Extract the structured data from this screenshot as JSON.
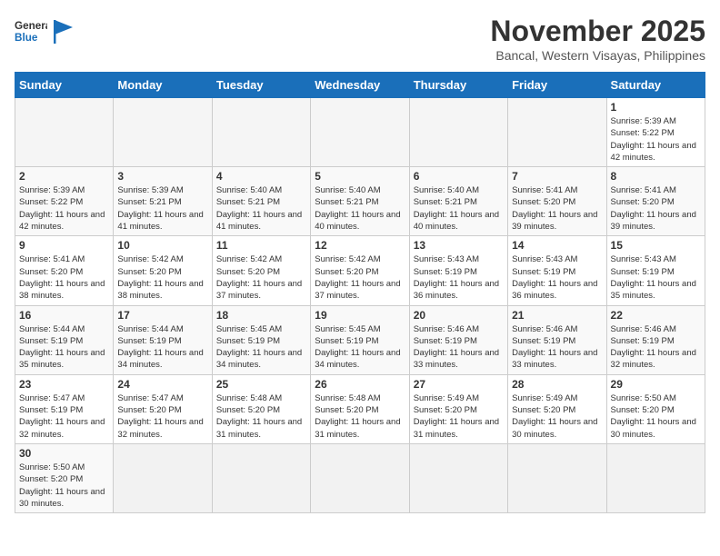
{
  "header": {
    "logo_line1": "General",
    "logo_line2": "Blue",
    "month_title": "November 2025",
    "location": "Bancal, Western Visayas, Philippines"
  },
  "weekdays": [
    "Sunday",
    "Monday",
    "Tuesday",
    "Wednesday",
    "Thursday",
    "Friday",
    "Saturday"
  ],
  "days": [
    {
      "date": null,
      "info": ""
    },
    {
      "date": null,
      "info": ""
    },
    {
      "date": null,
      "info": ""
    },
    {
      "date": null,
      "info": ""
    },
    {
      "date": null,
      "info": ""
    },
    {
      "date": null,
      "info": ""
    },
    {
      "date": "1",
      "info": "Sunrise: 5:39 AM\nSunset: 5:22 PM\nDaylight: 11 hours and 42 minutes."
    },
    {
      "date": "2",
      "info": "Sunrise: 5:39 AM\nSunset: 5:22 PM\nDaylight: 11 hours and 42 minutes."
    },
    {
      "date": "3",
      "info": "Sunrise: 5:39 AM\nSunset: 5:21 PM\nDaylight: 11 hours and 41 minutes."
    },
    {
      "date": "4",
      "info": "Sunrise: 5:40 AM\nSunset: 5:21 PM\nDaylight: 11 hours and 41 minutes."
    },
    {
      "date": "5",
      "info": "Sunrise: 5:40 AM\nSunset: 5:21 PM\nDaylight: 11 hours and 40 minutes."
    },
    {
      "date": "6",
      "info": "Sunrise: 5:40 AM\nSunset: 5:21 PM\nDaylight: 11 hours and 40 minutes."
    },
    {
      "date": "7",
      "info": "Sunrise: 5:41 AM\nSunset: 5:20 PM\nDaylight: 11 hours and 39 minutes."
    },
    {
      "date": "8",
      "info": "Sunrise: 5:41 AM\nSunset: 5:20 PM\nDaylight: 11 hours and 39 minutes."
    },
    {
      "date": "9",
      "info": "Sunrise: 5:41 AM\nSunset: 5:20 PM\nDaylight: 11 hours and 38 minutes."
    },
    {
      "date": "10",
      "info": "Sunrise: 5:42 AM\nSunset: 5:20 PM\nDaylight: 11 hours and 38 minutes."
    },
    {
      "date": "11",
      "info": "Sunrise: 5:42 AM\nSunset: 5:20 PM\nDaylight: 11 hours and 37 minutes."
    },
    {
      "date": "12",
      "info": "Sunrise: 5:42 AM\nSunset: 5:20 PM\nDaylight: 11 hours and 37 minutes."
    },
    {
      "date": "13",
      "info": "Sunrise: 5:43 AM\nSunset: 5:19 PM\nDaylight: 11 hours and 36 minutes."
    },
    {
      "date": "14",
      "info": "Sunrise: 5:43 AM\nSunset: 5:19 PM\nDaylight: 11 hours and 36 minutes."
    },
    {
      "date": "15",
      "info": "Sunrise: 5:43 AM\nSunset: 5:19 PM\nDaylight: 11 hours and 35 minutes."
    },
    {
      "date": "16",
      "info": "Sunrise: 5:44 AM\nSunset: 5:19 PM\nDaylight: 11 hours and 35 minutes."
    },
    {
      "date": "17",
      "info": "Sunrise: 5:44 AM\nSunset: 5:19 PM\nDaylight: 11 hours and 34 minutes."
    },
    {
      "date": "18",
      "info": "Sunrise: 5:45 AM\nSunset: 5:19 PM\nDaylight: 11 hours and 34 minutes."
    },
    {
      "date": "19",
      "info": "Sunrise: 5:45 AM\nSunset: 5:19 PM\nDaylight: 11 hours and 34 minutes."
    },
    {
      "date": "20",
      "info": "Sunrise: 5:46 AM\nSunset: 5:19 PM\nDaylight: 11 hours and 33 minutes."
    },
    {
      "date": "21",
      "info": "Sunrise: 5:46 AM\nSunset: 5:19 PM\nDaylight: 11 hours and 33 minutes."
    },
    {
      "date": "22",
      "info": "Sunrise: 5:46 AM\nSunset: 5:19 PM\nDaylight: 11 hours and 32 minutes."
    },
    {
      "date": "23",
      "info": "Sunrise: 5:47 AM\nSunset: 5:19 PM\nDaylight: 11 hours and 32 minutes."
    },
    {
      "date": "24",
      "info": "Sunrise: 5:47 AM\nSunset: 5:20 PM\nDaylight: 11 hours and 32 minutes."
    },
    {
      "date": "25",
      "info": "Sunrise: 5:48 AM\nSunset: 5:20 PM\nDaylight: 11 hours and 31 minutes."
    },
    {
      "date": "26",
      "info": "Sunrise: 5:48 AM\nSunset: 5:20 PM\nDaylight: 11 hours and 31 minutes."
    },
    {
      "date": "27",
      "info": "Sunrise: 5:49 AM\nSunset: 5:20 PM\nDaylight: 11 hours and 31 minutes."
    },
    {
      "date": "28",
      "info": "Sunrise: 5:49 AM\nSunset: 5:20 PM\nDaylight: 11 hours and 30 minutes."
    },
    {
      "date": "29",
      "info": "Sunrise: 5:50 AM\nSunset: 5:20 PM\nDaylight: 11 hours and 30 minutes."
    },
    {
      "date": "30",
      "info": "Sunrise: 5:50 AM\nSunset: 5:20 PM\nDaylight: 11 hours and 30 minutes."
    },
    {
      "date": null,
      "info": ""
    },
    {
      "date": null,
      "info": ""
    },
    {
      "date": null,
      "info": ""
    },
    {
      "date": null,
      "info": ""
    },
    {
      "date": null,
      "info": ""
    },
    {
      "date": null,
      "info": ""
    }
  ]
}
